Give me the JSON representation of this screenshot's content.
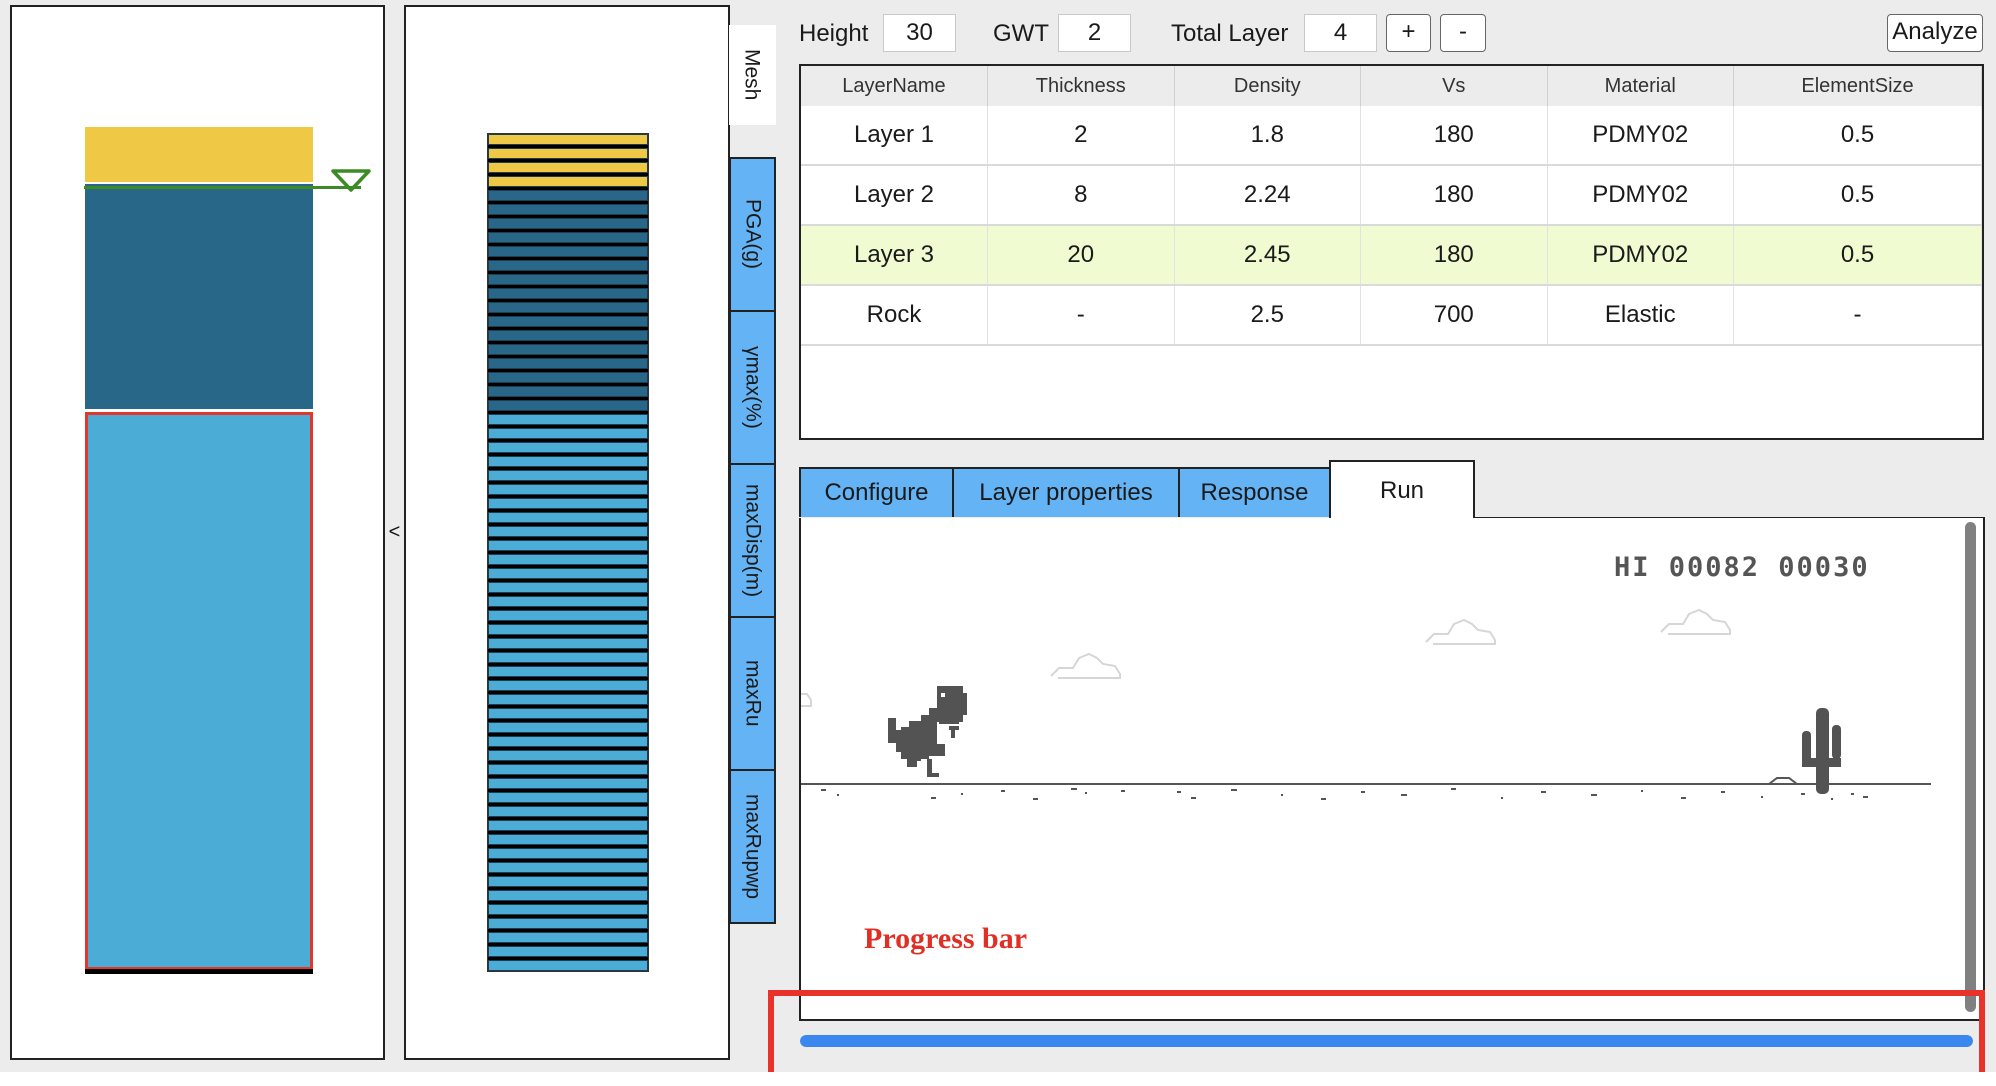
{
  "controls": {
    "height_label": "Height",
    "height_value": "30",
    "gwt_label": "GWT",
    "gwt_value": "2",
    "total_layer_label": "Total Layer",
    "total_layer_value": "4",
    "add_label": "+",
    "remove_label": "-",
    "analyze_label": "Analyze"
  },
  "soil_profile": {
    "collapse_label": "<",
    "colors": {
      "layer1": "#efc845",
      "layer2": "#286788",
      "layer3": "#4badd6",
      "selected_outline": "#e5362b",
      "water_table": "#3b8a26",
      "base": "#000000"
    },
    "selected_layer": "Layer 3"
  },
  "mesh": {
    "element_counts": [
      4,
      16,
      40
    ],
    "colors": [
      "#efc845",
      "#286788",
      "#4badd6"
    ]
  },
  "vertical_tabs": [
    {
      "label": "Mesh",
      "active": true
    },
    {
      "label": "PGA(g)",
      "active": false
    },
    {
      "label": "γmax(%)",
      "active": false
    },
    {
      "label": "maxDisp(m)",
      "active": false
    },
    {
      "label": "maxRu",
      "active": false
    },
    {
      "label": "maxRupwp",
      "active": false
    }
  ],
  "table": {
    "columns": [
      "LayerName",
      "Thickness",
      "Density",
      "Vs",
      "Material",
      "ElementSize"
    ],
    "rows": [
      [
        "Layer 1",
        "2",
        "1.8",
        "180",
        "PDMY02",
        "0.5"
      ],
      [
        "Layer 2",
        "8",
        "2.24",
        "180",
        "PDMY02",
        "0.5"
      ],
      [
        "Layer 3",
        "20",
        "2.45",
        "180",
        "PDMY02",
        "0.5"
      ],
      [
        "Rock",
        "-",
        "2.5",
        "700",
        "Elastic",
        "-"
      ]
    ],
    "selected_row": 2
  },
  "tabs": [
    {
      "label": "Configure",
      "active": false
    },
    {
      "label": "Layer properties",
      "active": false
    },
    {
      "label": "Response",
      "active": false
    },
    {
      "label": "Run",
      "active": true
    }
  ],
  "game": {
    "score_text": "HI 00082 00030",
    "high_score": "00082",
    "current_score": "00030"
  },
  "progress": {
    "annotation": "Progress bar",
    "percent": 100,
    "color": "#3a87ef"
  }
}
